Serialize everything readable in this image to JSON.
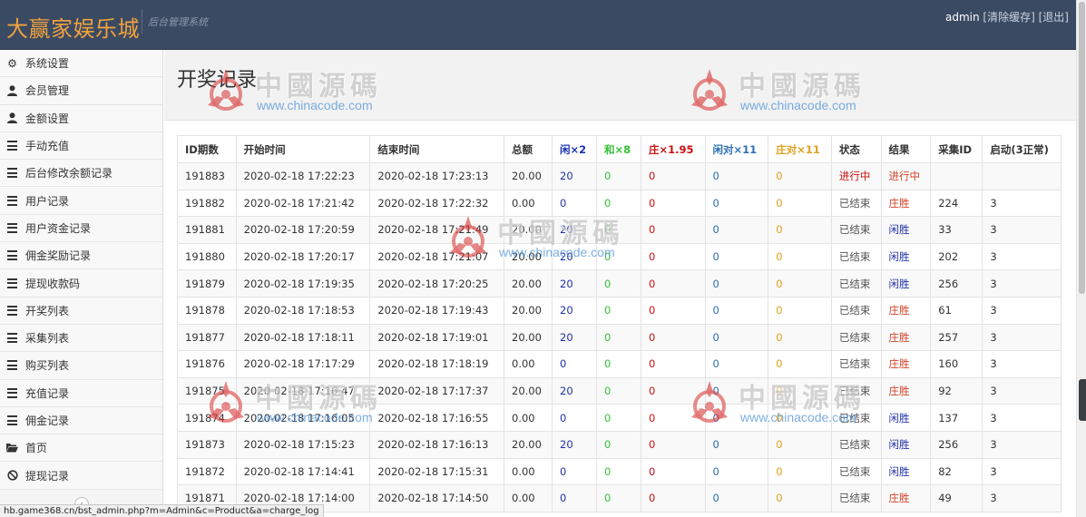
{
  "header": {
    "brand": "大赢家娱乐城",
    "subtitle": "后台管理系统",
    "username": "admin",
    "clear_cache": "[清除缓存]",
    "logout": "[退出]"
  },
  "sidebar": {
    "items": [
      {
        "label": "系统设置",
        "icon": "gear-icon"
      },
      {
        "label": "会员管理",
        "icon": "user-icon"
      },
      {
        "label": "金额设置",
        "icon": "user-icon"
      },
      {
        "label": "手动充值",
        "icon": "list-icon"
      },
      {
        "label": "后台修改余额记录",
        "icon": "list-icon"
      },
      {
        "label": "用户记录",
        "icon": "list-icon"
      },
      {
        "label": "用户资金记录",
        "icon": "list-icon"
      },
      {
        "label": "佣金奖励记录",
        "icon": "list-icon"
      },
      {
        "label": "提现收款码",
        "icon": "list-icon"
      },
      {
        "label": "开奖列表",
        "icon": "list-icon"
      },
      {
        "label": "采集列表",
        "icon": "list-icon"
      },
      {
        "label": "购买列表",
        "icon": "list-icon"
      },
      {
        "label": "充值记录",
        "icon": "list-icon"
      },
      {
        "label": "佣金记录",
        "icon": "list-icon"
      },
      {
        "label": "首页",
        "icon": "folder-open-icon"
      },
      {
        "label": "提现记录",
        "icon": "ban-icon"
      }
    ]
  },
  "main": {
    "title": "开奖记录",
    "columns": [
      "ID期数",
      "开始时间",
      "结束时间",
      "总额",
      "闲×2",
      "和×8",
      "庄×1.95",
      "闲对×11",
      "庄对×11",
      "状态",
      "结果",
      "采集ID",
      "启动(3正常)"
    ],
    "column_colors": [
      "",
      "",
      "",
      "",
      "#1c33b8",
      "#34c234",
      "#cc1111",
      "#2c6fb5",
      "#e0a01e",
      "",
      "",
      "",
      ""
    ],
    "rows": [
      [
        "191883",
        "2020-02-18 17:22:23",
        "2020-02-18 17:23:13",
        "20.00",
        "20",
        "0",
        "0",
        "0",
        "0",
        "进行中",
        "进行中",
        "",
        ""
      ],
      [
        "191882",
        "2020-02-18 17:21:42",
        "2020-02-18 17:22:32",
        "0.00",
        "0",
        "0",
        "0",
        "0",
        "0",
        "已结束",
        "庄胜",
        "224",
        "3"
      ],
      [
        "191881",
        "2020-02-18 17:20:59",
        "2020-02-18 17:21:49",
        "20.00",
        "20",
        "0",
        "0",
        "0",
        "0",
        "已结束",
        "闲胜",
        "33",
        "3"
      ],
      [
        "191880",
        "2020-02-18 17:20:17",
        "2020-02-18 17:21:07",
        "20.00",
        "20",
        "0",
        "0",
        "0",
        "0",
        "已结束",
        "闲胜",
        "202",
        "3"
      ],
      [
        "191879",
        "2020-02-18 17:19:35",
        "2020-02-18 17:20:25",
        "20.00",
        "20",
        "0",
        "0",
        "0",
        "0",
        "已结束",
        "闲胜",
        "256",
        "3"
      ],
      [
        "191878",
        "2020-02-18 17:18:53",
        "2020-02-18 17:19:43",
        "20.00",
        "20",
        "0",
        "0",
        "0",
        "0",
        "已结束",
        "庄胜",
        "61",
        "3"
      ],
      [
        "191877",
        "2020-02-18 17:18:11",
        "2020-02-18 17:19:01",
        "20.00",
        "20",
        "0",
        "0",
        "0",
        "0",
        "已结束",
        "庄胜",
        "257",
        "3"
      ],
      [
        "191876",
        "2020-02-18 17:17:29",
        "2020-02-18 17:18:19",
        "0.00",
        "0",
        "0",
        "0",
        "0",
        "0",
        "已结束",
        "庄胜",
        "160",
        "3"
      ],
      [
        "191875",
        "2020-02-18 17:16:47",
        "2020-02-18 17:17:37",
        "20.00",
        "20",
        "0",
        "0",
        "0",
        "0",
        "已结束",
        "庄胜",
        "92",
        "3"
      ],
      [
        "191874",
        "2020-02-18 17:16:05",
        "2020-02-18 17:16:55",
        "0.00",
        "0",
        "0",
        "0",
        "0",
        "0",
        "已结束",
        "闲胜",
        "137",
        "3"
      ],
      [
        "191873",
        "2020-02-18 17:15:23",
        "2020-02-18 17:16:13",
        "20.00",
        "20",
        "0",
        "0",
        "0",
        "0",
        "已结束",
        "闲胜",
        "256",
        "3"
      ],
      [
        "191872",
        "2020-02-18 17:14:41",
        "2020-02-18 17:15:31",
        "0.00",
        "0",
        "0",
        "0",
        "0",
        "0",
        "已结束",
        "闲胜",
        "82",
        "3"
      ],
      [
        "191871",
        "2020-02-18 17:14:00",
        "2020-02-18 17:14:50",
        "0.00",
        "0",
        "0",
        "0",
        "0",
        "0",
        "已结束",
        "庄胜",
        "49",
        "3"
      ]
    ]
  },
  "watermark": {
    "chinese": "中國源碼",
    "url": "www.chinacode.com"
  },
  "status_bar": {
    "url": "hb.game368.cn/bst_admin.php?m=Admin&c=Product&a=charge_log"
  }
}
